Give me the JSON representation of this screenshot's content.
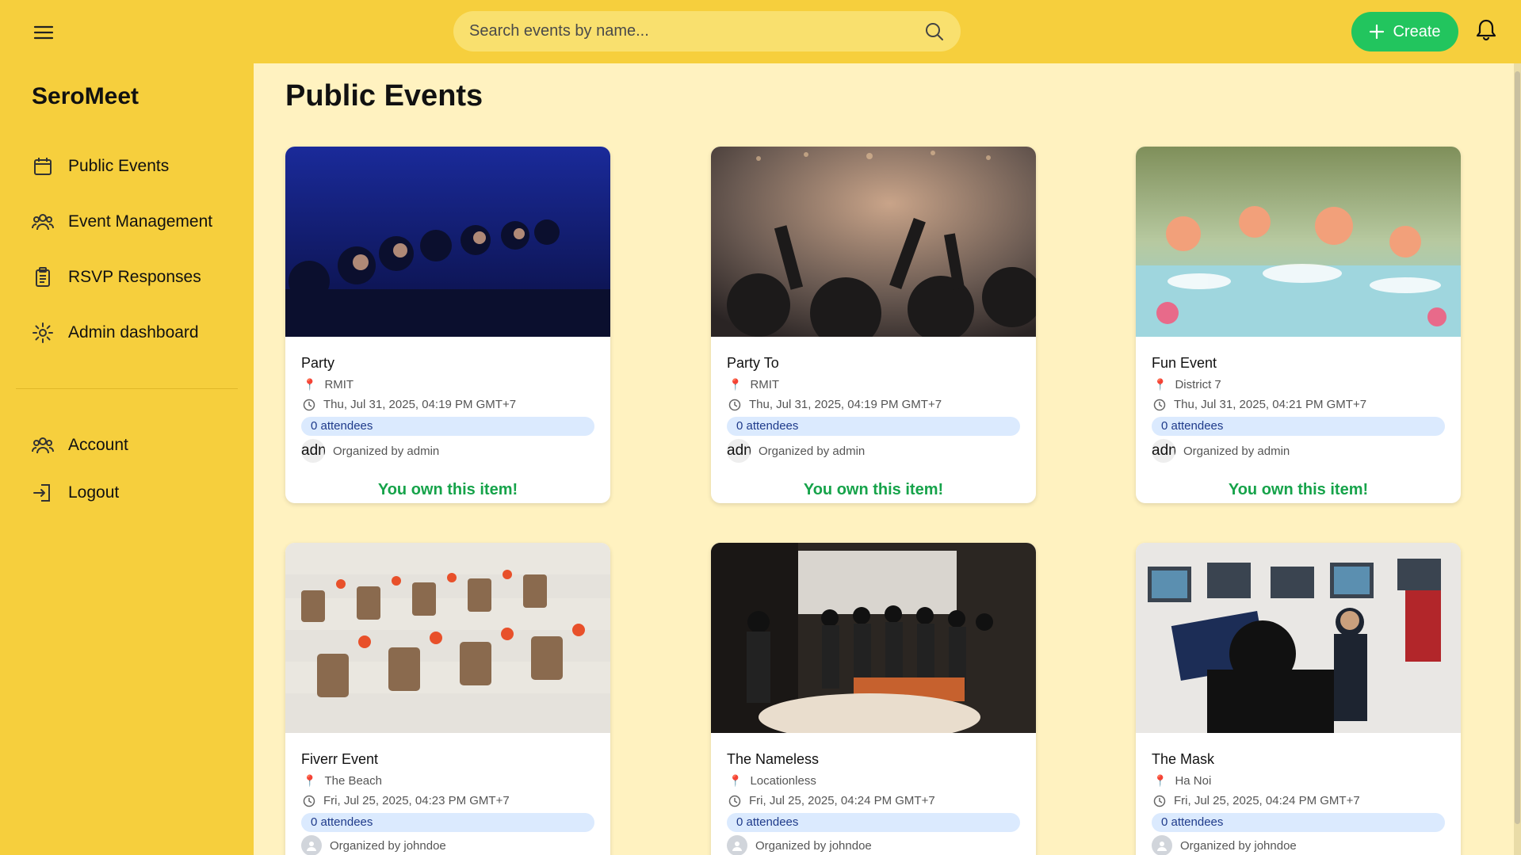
{
  "app": {
    "brand": "SeroMeet"
  },
  "header": {
    "search_placeholder": "Search events by name...",
    "create_label": "Create"
  },
  "sidebar": {
    "items": [
      {
        "label": "Public Events",
        "icon": "calendar-icon"
      },
      {
        "label": "Event Management",
        "icon": "users-icon"
      },
      {
        "label": "RSVP Responses",
        "icon": "clipboard-icon"
      },
      {
        "label": "Admin dashboard",
        "icon": "gear-icon"
      }
    ],
    "bottom_items": [
      {
        "label": "Account",
        "icon": "users-icon"
      },
      {
        "label": "Logout",
        "icon": "logout-icon"
      }
    ]
  },
  "main": {
    "title": "Public Events",
    "events": [
      {
        "title": "Party",
        "location": "RMIT",
        "datetime": "Thu, Jul 31, 2025, 04:19 PM GMT+7",
        "attendees": "0 attendees",
        "avatar_text": "adn",
        "organizer": "Organized by admin",
        "owned_label": "You own this item!"
      },
      {
        "title": "Party To",
        "location": "RMIT",
        "datetime": "Thu, Jul 31, 2025, 04:19 PM GMT+7",
        "attendees": "0 attendees",
        "avatar_text": "adn",
        "organizer": "Organized by admin",
        "owned_label": "You own this item!"
      },
      {
        "title": "Fun Event",
        "location": "District 7",
        "datetime": "Thu, Jul 31, 2025, 04:21 PM GMT+7",
        "attendees": "0 attendees",
        "avatar_text": "adn",
        "organizer": "Organized by admin",
        "owned_label": "You own this item!"
      },
      {
        "title": "Fiverr Event",
        "location": "The Beach",
        "datetime": "Fri, Jul 25, 2025, 04:23 PM GMT+7",
        "attendees": "0 attendees",
        "organizer": "Organized by johndoe"
      },
      {
        "title": "The Nameless",
        "location": "Locationless",
        "datetime": "Fri, Jul 25, 2025, 04:24 PM GMT+7",
        "attendees": "0 attendees",
        "organizer": "Organized by johndoe"
      },
      {
        "title": "The Mask",
        "location": "Ha Noi",
        "datetime": "Fri, Jul 25, 2025, 04:24 PM GMT+7",
        "attendees": "0 attendees",
        "organizer": "Organized by johndoe"
      }
    ]
  },
  "colors": {
    "topbar": "#f6cf3d",
    "content_bg": "#fff2c0",
    "accent_green": "#22c55e",
    "owned_text": "#16a34a",
    "attendee_pill": "#dbeafe"
  }
}
